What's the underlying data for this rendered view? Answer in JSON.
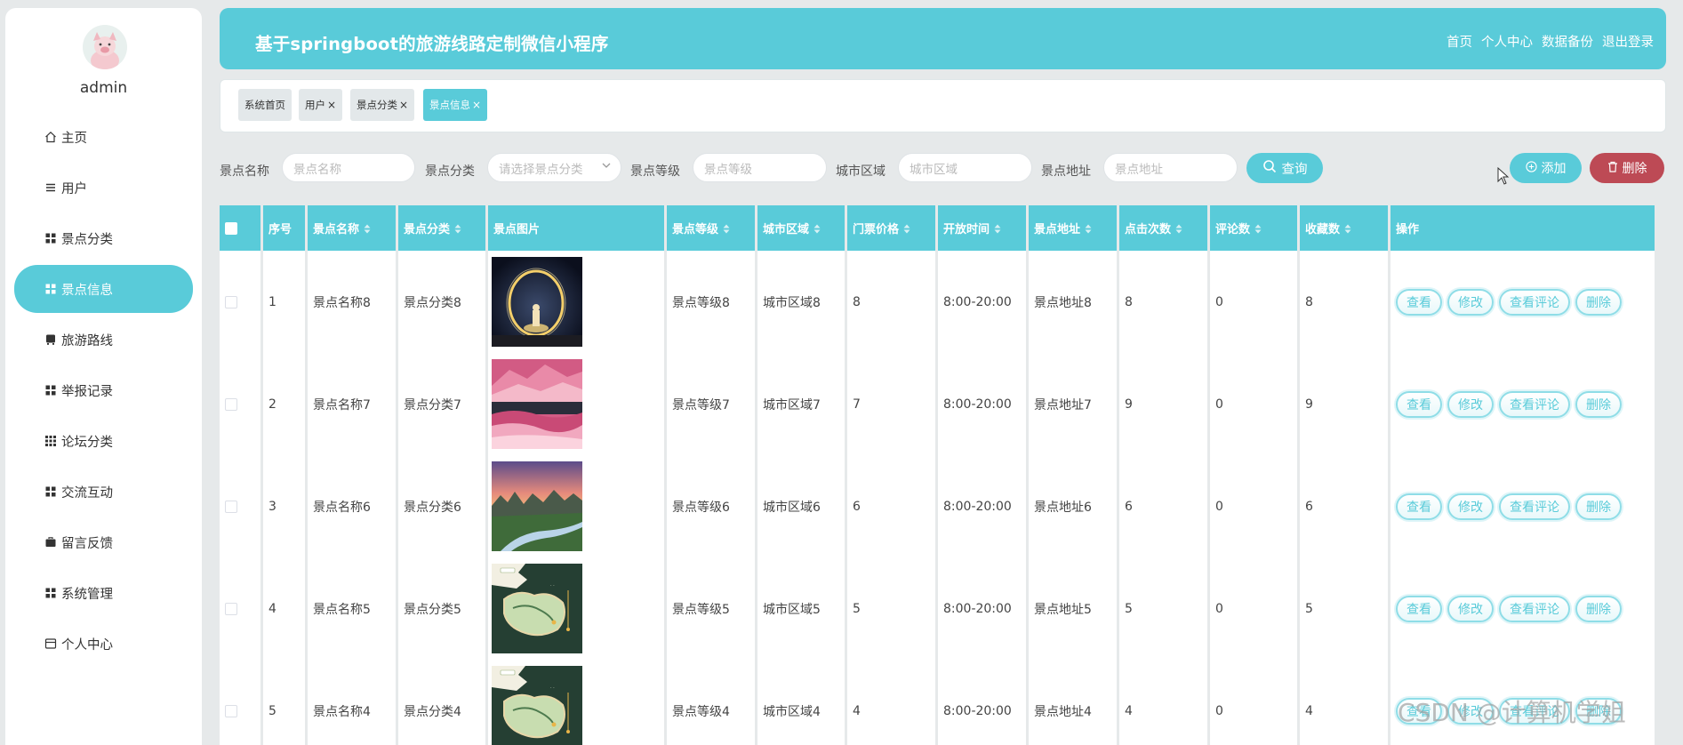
{
  "sidebar": {
    "username": "admin",
    "items": [
      {
        "label": "主页",
        "icon": "home-icon",
        "active": false
      },
      {
        "label": "用户",
        "icon": "list-icon",
        "active": false
      },
      {
        "label": "景点分类",
        "icon": "grid-icon",
        "active": false
      },
      {
        "label": "景点信息",
        "icon": "grid-icon",
        "active": true
      },
      {
        "label": "旅游路线",
        "icon": "bus-icon",
        "active": false
      },
      {
        "label": "举报记录",
        "icon": "grid-icon",
        "active": false
      },
      {
        "label": "论坛分类",
        "icon": "apps-icon",
        "active": false
      },
      {
        "label": "交流互动",
        "icon": "grid-icon",
        "active": false
      },
      {
        "label": "留言反馈",
        "icon": "briefcase-icon",
        "active": false
      },
      {
        "label": "系统管理",
        "icon": "grid-icon",
        "active": false
      },
      {
        "label": "个人中心",
        "icon": "card-icon",
        "active": false
      }
    ]
  },
  "header": {
    "title": "基于springboot的旅游线路定制微信小程序",
    "links": [
      "首页",
      "个人中心",
      "数据备份",
      "退出登录"
    ]
  },
  "tabs": [
    {
      "label": "系统首页",
      "closable": false,
      "active": false
    },
    {
      "label": "用户",
      "closable": true,
      "active": false
    },
    {
      "label": "景点分类",
      "closable": true,
      "active": false
    },
    {
      "label": "景点信息",
      "closable": true,
      "active": true
    }
  ],
  "tab_close_glyph": "×",
  "search": {
    "name_label": "景点名称",
    "name_placeholder": "景点名称",
    "category_label": "景点分类",
    "category_placeholder": "请选择景点分类",
    "level_label": "景点等级",
    "level_placeholder": "景点等级",
    "district_label": "城市区域",
    "district_placeholder": "城市区域",
    "address_label": "景点地址",
    "address_placeholder": "景点地址",
    "query_label": "查询",
    "add_label": "添加",
    "delete_label": "删除"
  },
  "table": {
    "columns": [
      "序号",
      "景点名称",
      "景点分类",
      "景点图片",
      "景点等级",
      "城市区域",
      "门票价格",
      "开放时间",
      "景点地址",
      "点击次数",
      "评论数",
      "收藏数",
      "操作"
    ],
    "sortable": [
      false,
      true,
      true,
      false,
      true,
      true,
      true,
      true,
      true,
      true,
      true,
      true,
      false
    ],
    "row_actions": [
      "查看",
      "修改",
      "查看评论",
      "删除"
    ],
    "rows": [
      {
        "index": "1",
        "name": "景点名称8",
        "category": "景点分类8",
        "image": "night-portal",
        "level": "景点等级8",
        "district": "城市区域8",
        "price": "8",
        "hours": "8:00-20:00",
        "address": "景点地址8",
        "clicks": "8",
        "comments": "0",
        "favorites": "8"
      },
      {
        "index": "2",
        "name": "景点名称7",
        "category": "景点分类7",
        "image": "pink-mountain",
        "level": "景点等级7",
        "district": "城市区域7",
        "price": "7",
        "hours": "8:00-20:00",
        "address": "景点地址7",
        "clicks": "9",
        "comments": "0",
        "favorites": "9"
      },
      {
        "index": "3",
        "name": "景点名称6",
        "category": "景点分类6",
        "image": "river-sunset",
        "level": "景点等级6",
        "district": "城市区域6",
        "price": "6",
        "hours": "8:00-20:00",
        "address": "景点地址6",
        "clicks": "6",
        "comments": "0",
        "favorites": "6"
      },
      {
        "index": "4",
        "name": "景点名称5",
        "category": "景点分类5",
        "image": "map-card",
        "level": "景点等级5",
        "district": "城市区域5",
        "price": "5",
        "hours": "8:00-20:00",
        "address": "景点地址5",
        "clicks": "5",
        "comments": "0",
        "favorites": "5"
      },
      {
        "index": "5",
        "name": "景点名称4",
        "category": "景点分类4",
        "image": "map-card",
        "level": "景点等级4",
        "district": "城市区域4",
        "price": "4",
        "hours": "8:00-20:00",
        "address": "景点地址4",
        "clicks": "4",
        "comments": "0",
        "favorites": "4"
      }
    ]
  },
  "watermark": "CSDN @计算机学姐",
  "colors": {
    "accent": "#59cbd9",
    "danger": "#bd4a55",
    "background": "#e6e9ea"
  }
}
